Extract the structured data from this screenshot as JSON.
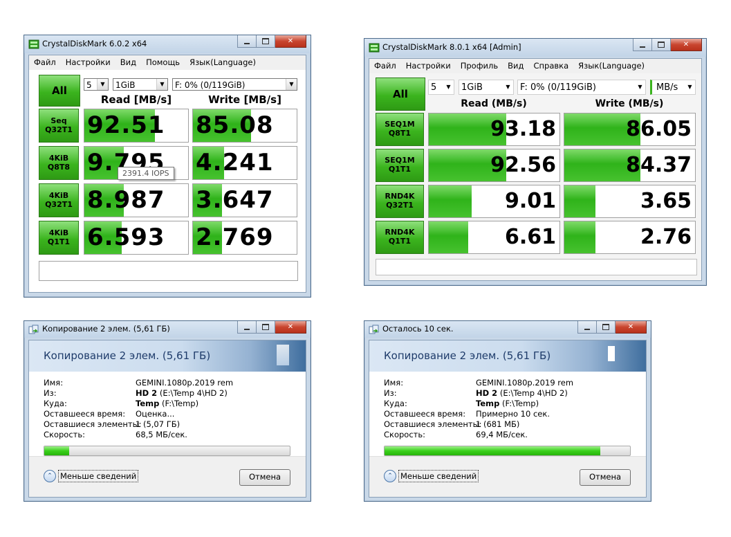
{
  "cdm6": {
    "title": "CrystalDiskMark 6.0.2 x64",
    "menu": [
      "Файл",
      "Настройки",
      "Вид",
      "Помощь",
      "Язык(Language)"
    ],
    "all_label": "All",
    "count": "5",
    "size": "1GiB",
    "drive": "F: 0% (0/119GiB)",
    "read_header": "Read [MB/s]",
    "write_header": "Write [MB/s]",
    "tooltip": "2391.4 IOPS",
    "rows": [
      {
        "l1": "Seq",
        "l2": "Q32T1",
        "read": "92.51",
        "write": "85.08",
        "read_fill": 0.68,
        "write_fill": 0.56
      },
      {
        "l1": "4KiB",
        "l2": "Q8T8",
        "read": "9.795",
        "write": "4.241",
        "read_fill": 0.38,
        "write_fill": 0.3
      },
      {
        "l1": "4KiB",
        "l2": "Q32T1",
        "read": "8.987",
        "write": "3.647",
        "read_fill": 0.38,
        "write_fill": 0.28
      },
      {
        "l1": "4KiB",
        "l2": "Q1T1",
        "read": "6.593",
        "write": "2.769",
        "read_fill": 0.36,
        "write_fill": 0.28
      }
    ]
  },
  "cdm8": {
    "title": "CrystalDiskMark 8.0.1 x64 [Admin]",
    "menu": [
      "Файл",
      "Настройки",
      "Профиль",
      "Вид",
      "Справка",
      "Язык(Language)"
    ],
    "all_label": "All",
    "count": "5",
    "size": "1GiB",
    "drive": "F: 0% (0/119GiB)",
    "unit": "MB/s",
    "read_header": "Read (MB/s)",
    "write_header": "Write (MB/s)",
    "rows": [
      {
        "l1": "SEQ1M",
        "l2": "Q8T1",
        "read": "93.18",
        "write": "86.05",
        "read_fill": 0.59,
        "write_fill": 0.58
      },
      {
        "l1": "SEQ1M",
        "l2": "Q1T1",
        "read": "92.56",
        "write": "84.37",
        "read_fill": 0.59,
        "write_fill": 0.58
      },
      {
        "l1": "RND4K",
        "l2": "Q32T1",
        "read": "9.01",
        "write": "3.65",
        "read_fill": 0.33,
        "write_fill": 0.24
      },
      {
        "l1": "RND4K",
        "l2": "Q1T1",
        "read": "6.61",
        "write": "2.76",
        "read_fill": 0.3,
        "write_fill": 0.24
      }
    ]
  },
  "copy1": {
    "title": "Копирование 2 элем. (5,61 ГБ)",
    "heading": "Копирование 2 элем. (5,61 ГБ)",
    "name_label": "Имя:",
    "name_value": "GEMINI.1080p.2019 rem",
    "from_label": "Из:",
    "from_bold": "HD 2",
    "from_rest": " (E:\\Temp 4\\HD 2)",
    "to_label": "Куда:",
    "to_bold": "Temp",
    "to_rest": " (F:\\Temp)",
    "time_label": "Оставшееся время:",
    "time_value": "Оценка...",
    "items_label": "Оставшиеся элементы:",
    "items_value": "1 (5,07 ГБ)",
    "speed_label": "Скорость:",
    "speed_value": "68,5 МБ/сек.",
    "progress": 0.1,
    "less_label": "Меньше сведений",
    "cancel_label": "Отмена"
  },
  "copy2": {
    "title": "Осталось 10 сек.",
    "heading": "Копирование 2 элем. (5,61 ГБ)",
    "name_label": "Имя:",
    "name_value": "GEMINI.1080p.2019 rem",
    "from_label": "Из:",
    "from_bold": "HD 2",
    "from_rest": " (E:\\Temp 4\\HD 2)",
    "to_label": "Куда:",
    "to_bold": "Temp",
    "to_rest": " (F:\\Temp)",
    "time_label": "Оставшееся время:",
    "time_value": "Примерно 10 сек.",
    "items_label": "Оставшиеся элементы:",
    "items_value": "1 (681 МБ)",
    "speed_label": "Скорость:",
    "speed_value": "69,4 МБ/сек.",
    "progress": 0.88,
    "less_label": "Меньше сведений",
    "cancel_label": "Отмена"
  }
}
